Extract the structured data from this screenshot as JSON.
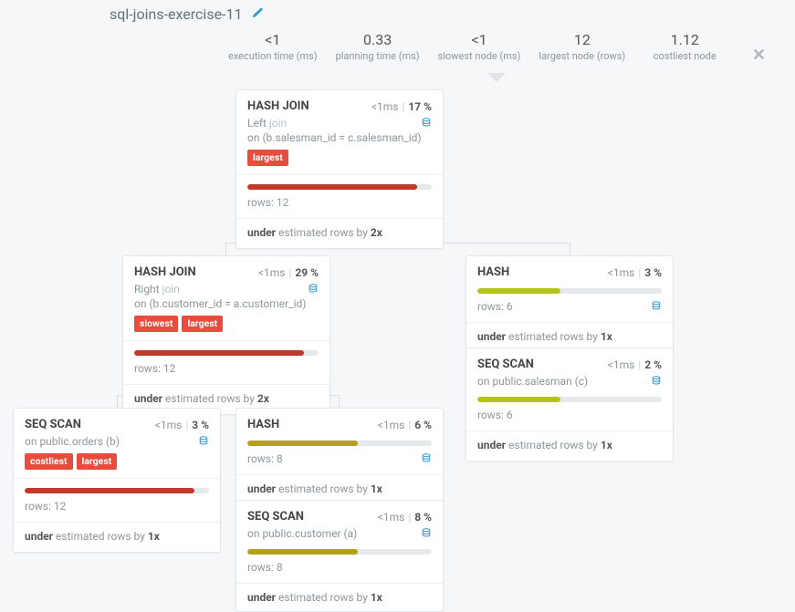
{
  "header": {
    "title": "sql-joins-exercise-11"
  },
  "metrics": {
    "exec": {
      "value": "<1",
      "label": "execution time (ms)"
    },
    "plan": {
      "value": "0.33",
      "label": "planning time (ms)"
    },
    "slow": {
      "value": "<1",
      "label": "slowest node (ms)"
    },
    "large": {
      "value": "12",
      "label": "largest node (rows)"
    },
    "cost": {
      "value": "1.12",
      "label": "costliest node"
    }
  },
  "nodes": {
    "n1": {
      "title": "HASH JOIN",
      "time": "<1ms",
      "pct": "17 %",
      "joinSide": "Left",
      "joinWord": "join",
      "condition": "on (b.salesman_id = c.salesman_id)",
      "badges": [
        "largest"
      ],
      "barColor": "red",
      "barPct": 92,
      "rows": "rows: 12",
      "est_pre": "under",
      "est_mid": " estimated rows by ",
      "est_factor": "2x"
    },
    "n2": {
      "title": "HASH JOIN",
      "time": "<1ms",
      "pct": "29 %",
      "joinSide": "Right",
      "joinWord": "join",
      "condition": "on (b.customer_id = a.customer_id)",
      "badges": [
        "slowest",
        "largest"
      ],
      "barColor": "red",
      "barPct": 92,
      "rows": "rows: 12",
      "est_pre": "under",
      "est_mid": " estimated rows by ",
      "est_factor": "2x"
    },
    "n3": {
      "title": "HASH",
      "time": "<1ms",
      "pct": "3 %",
      "barColor": "yellowgreen",
      "barPct": 45,
      "rows": "rows: 6",
      "est_pre": "under",
      "est_mid": " estimated rows by ",
      "est_factor": "1x"
    },
    "n4": {
      "title": "SEQ SCAN",
      "time": "<1ms",
      "pct": "3 %",
      "subText": "on public.orders (b)",
      "badges": [
        "costliest",
        "largest"
      ],
      "barColor": "red",
      "barPct": 92,
      "rows": "rows: 12",
      "est_pre": "under",
      "est_mid": " estimated rows by ",
      "est_factor": "1x"
    },
    "n5": {
      "title": "HASH",
      "time": "<1ms",
      "pct": "6 %",
      "barColor": "olive",
      "barPct": 60,
      "rows": "rows: 8",
      "est_pre": "under",
      "est_mid": " estimated rows by ",
      "est_factor": "1x"
    },
    "n6": {
      "title": "SEQ SCAN",
      "time": "<1ms",
      "pct": "2 %",
      "subText": "on public.salesman (c)",
      "barColor": "yellowgreen",
      "barPct": 45,
      "rows": "rows: 6",
      "est_pre": "under",
      "est_mid": " estimated rows by ",
      "est_factor": "1x"
    },
    "n7": {
      "title": "SEQ SCAN",
      "time": "<1ms",
      "pct": "8 %",
      "subText": "on public.customer (a)",
      "barColor": "olive",
      "barPct": 60,
      "rows": "rows: 8",
      "est_pre": "under",
      "est_mid": " estimated rows by ",
      "est_factor": "1x"
    }
  }
}
